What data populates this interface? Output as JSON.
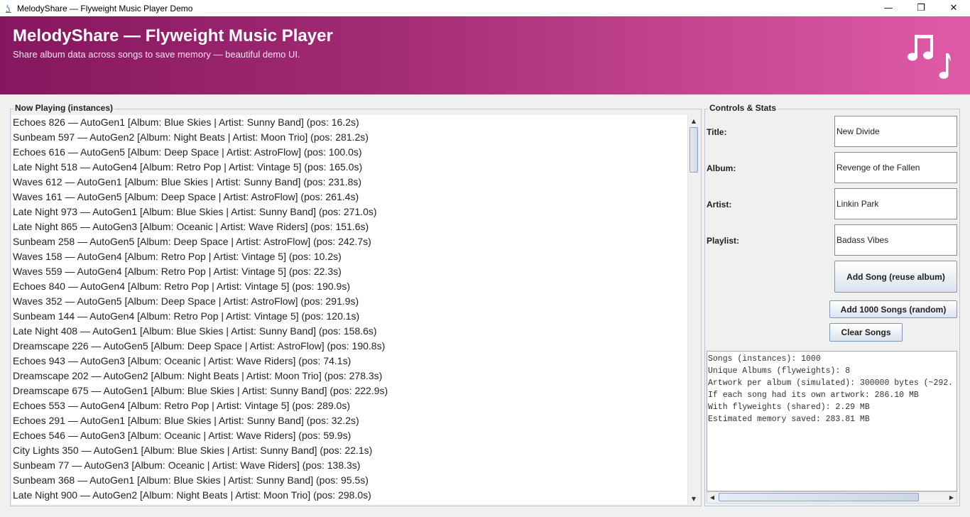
{
  "window": {
    "title": "MelodyShare — Flyweight Music Player Demo",
    "minimize": "—",
    "maximize": "❐",
    "close": "✕"
  },
  "header": {
    "title": "MelodyShare — Flyweight Music Player",
    "subtitle": "Share album data across songs to save memory — beautiful demo UI.",
    "icon": "music-notes-icon"
  },
  "now_playing": {
    "title": "Now Playing (instances)",
    "songs": [
      "Echoes 826 — AutoGen1 [Album: Blue Skies | Artist: Sunny Band] (pos: 16.2s)",
      "Sunbeam 597 — AutoGen2 [Album: Night Beats | Artist: Moon Trio] (pos: 281.2s)",
      "Echoes 616 — AutoGen5 [Album: Deep Space | Artist: AstroFlow] (pos: 100.0s)",
      "Late Night 518 — AutoGen4 [Album: Retro Pop | Artist: Vintage 5] (pos: 165.0s)",
      "Waves 612 — AutoGen1 [Album: Blue Skies | Artist: Sunny Band] (pos: 231.8s)",
      "Waves 161 — AutoGen5 [Album: Deep Space | Artist: AstroFlow] (pos: 261.4s)",
      "Late Night 973 — AutoGen1 [Album: Blue Skies | Artist: Sunny Band] (pos: 271.0s)",
      "Late Night 865 — AutoGen3 [Album: Oceanic | Artist: Wave Riders] (pos: 151.6s)",
      "Sunbeam 258 — AutoGen5 [Album: Deep Space | Artist: AstroFlow] (pos: 242.7s)",
      "Waves 158 — AutoGen4 [Album: Retro Pop | Artist: Vintage 5] (pos: 10.2s)",
      "Waves 559 — AutoGen4 [Album: Retro Pop | Artist: Vintage 5] (pos: 22.3s)",
      "Echoes 840 — AutoGen4 [Album: Retro Pop | Artist: Vintage 5] (pos: 190.9s)",
      "Waves 352 — AutoGen5 [Album: Deep Space | Artist: AstroFlow] (pos: 291.9s)",
      "Sunbeam 144 — AutoGen4 [Album: Retro Pop | Artist: Vintage 5] (pos: 120.1s)",
      "Late Night 408 — AutoGen1 [Album: Blue Skies | Artist: Sunny Band] (pos: 158.6s)",
      "Dreamscape 226 — AutoGen5 [Album: Deep Space | Artist: AstroFlow] (pos: 190.8s)",
      "Echoes 943 — AutoGen3 [Album: Oceanic | Artist: Wave Riders] (pos: 74.1s)",
      "Dreamscape 202 — AutoGen2 [Album: Night Beats | Artist: Moon Trio] (pos: 278.3s)",
      "Dreamscape 675 — AutoGen1 [Album: Blue Skies | Artist: Sunny Band] (pos: 222.9s)",
      "Echoes 553 — AutoGen4 [Album: Retro Pop | Artist: Vintage 5] (pos: 289.0s)",
      "Echoes 291 — AutoGen1 [Album: Blue Skies | Artist: Sunny Band] (pos: 32.2s)",
      "Echoes 546 — AutoGen3 [Album: Oceanic | Artist: Wave Riders] (pos: 59.9s)",
      "City Lights 350 — AutoGen1 [Album: Blue Skies | Artist: Sunny Band] (pos: 22.1s)",
      "Sunbeam 77 — AutoGen3 [Album: Oceanic | Artist: Wave Riders] (pos: 138.3s)",
      "Sunbeam 368 — AutoGen1 [Album: Blue Skies | Artist: Sunny Band] (pos: 95.5s)",
      "Late Night 900 — AutoGen2 [Album: Night Beats | Artist: Moon Trio] (pos: 298.0s)"
    ]
  },
  "controls": {
    "title": "Controls & Stats",
    "fields": [
      {
        "label": "Title:",
        "value": "New Divide"
      },
      {
        "label": "Album:",
        "value": "Revenge of the Fallen"
      },
      {
        "label": "Artist:",
        "value": "Linkin Park"
      },
      {
        "label": "Playlist:",
        "value": "Badass Vibes"
      }
    ],
    "add_song_label": "Add Song (reuse album)",
    "add_1000_label": "Add 1000 Songs (random)",
    "clear_label": "Clear Songs",
    "stats": [
      "Songs (instances): 1000",
      "Unique Albums (flyweights): 8",
      "Artwork per album (simulated): 300000 bytes (~292.",
      "If each song had its own artwork: 286.10 MB",
      "With flyweights (shared): 2.29 MB",
      "Estimated memory saved: 283.81 MB"
    ]
  },
  "colors": {
    "banner_start": "#86165f",
    "banner_end": "#e05aa8",
    "accent_border": "#b9c7d6"
  }
}
